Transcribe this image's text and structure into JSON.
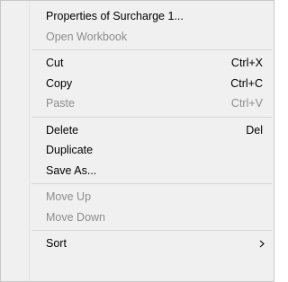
{
  "menu": {
    "group1": [
      {
        "label": "Properties of  Surcharge 1...",
        "disabled": false
      },
      {
        "label": "Open Workbook",
        "disabled": true
      }
    ],
    "group2": [
      {
        "label": "Cut",
        "shortcut": "Ctrl+X",
        "disabled": false
      },
      {
        "label": "Copy",
        "shortcut": "Ctrl+C",
        "disabled": false
      },
      {
        "label": "Paste",
        "shortcut": "Ctrl+V",
        "disabled": true
      }
    ],
    "group3": [
      {
        "label": "Delete",
        "shortcut": "Del",
        "disabled": false
      },
      {
        "label": "Duplicate",
        "disabled": false
      },
      {
        "label": "Save As...",
        "disabled": false
      }
    ],
    "group4": [
      {
        "label": "Move Up",
        "disabled": true
      },
      {
        "label": "Move Down",
        "disabled": true
      }
    ],
    "group5": [
      {
        "label": "Sort",
        "submenu_icon": "chevron-right-icon",
        "disabled": false
      }
    ],
    "colors": {
      "background": "#f0f0f0",
      "enabled_text": "#000000",
      "disabled_text": "#8d8d8d",
      "separator": "#d7d7d7"
    }
  }
}
